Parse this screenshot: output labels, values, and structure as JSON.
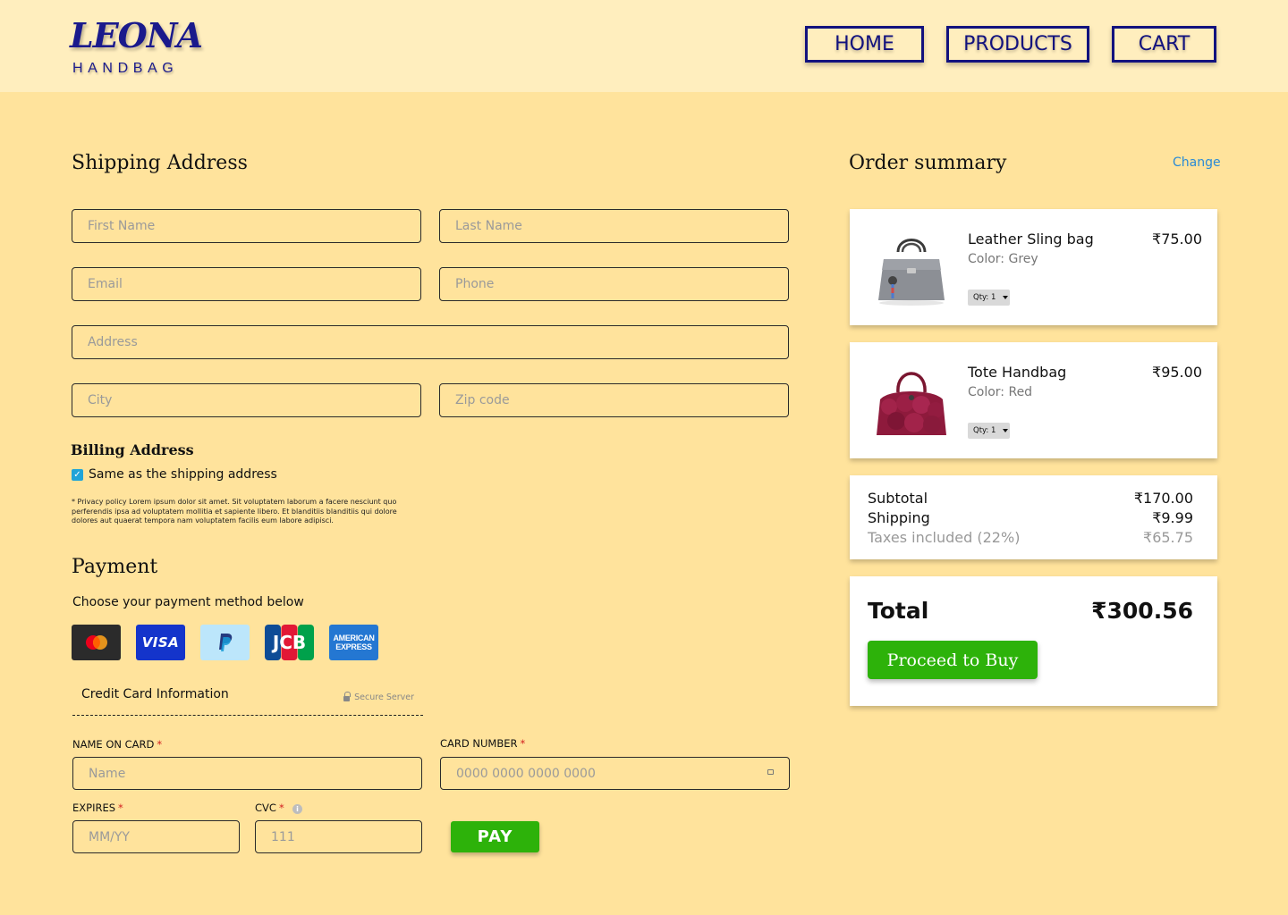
{
  "brand": {
    "mark": "LEONA",
    "sub": "HANDBAG",
    "color": "#1A1A8C"
  },
  "nav": {
    "home": "HOME",
    "products": "PRODUCTS",
    "cart": "CART"
  },
  "shipping": {
    "title": "Shipping Address",
    "first_name": "First Name",
    "last_name": "Last Name",
    "email": "Email",
    "phone": "Phone",
    "address": "Address",
    "city": "City",
    "zip": "Zip code"
  },
  "billing": {
    "title": "Billing Address",
    "same_as_shipping": "Same as the shipping address",
    "same_checked": true,
    "privacy": "* Privacy policy Lorem ipsum dolor sit amet. Sit voluptatem laborum a facere nesciunt quo perferendis ipsa ad voluptatem mollitia et sapiente libero. Et blanditiis blanditiis qui dolore dolores aut quaerat tempora nam voluptatem facilis eum labore adipisci."
  },
  "payment": {
    "title": "Payment",
    "subtitle": "Choose your payment method below",
    "methods": [
      "mastercard-icon",
      "visa-icon",
      "paypal-icon",
      "jcb-icon",
      "amex-icon"
    ],
    "visa_label": "VISA",
    "jcb_label": "JCB",
    "amex_line1": "AMERICAN",
    "amex_line2": "EXPRESS",
    "cc_title": "Credit Card Information",
    "secure": "Secure Server",
    "name_label": "NAME ON CARD",
    "name_placeholder": "Name",
    "number_label": "CARD NUMBER",
    "number_placeholder": "0000 0000 0000 0000",
    "expires_label": "EXPIRES",
    "expires_placeholder": "MM/YY",
    "cvc_label": "CVC",
    "cvc_placeholder": "111",
    "required_mark": "*",
    "pay": "PAY"
  },
  "summary": {
    "title": "Order summary",
    "change": "Change",
    "items": [
      {
        "name": "Leather Sling bag",
        "color": "Color: Grey",
        "price": "₹75.00",
        "qty": "Qty: 1"
      },
      {
        "name": "Tote Handbag",
        "color": "Color: Red",
        "price": "₹95.00",
        "qty": "Qty: 1"
      }
    ],
    "subtotal_label": "Subtotal",
    "subtotal": "₹170.00",
    "shipping_label": "Shipping",
    "shipping": "₹9.99",
    "taxes_label": "Taxes included (22%)",
    "taxes": "₹65.75",
    "total_label": "Total",
    "total": "₹300.56",
    "proceed": "Proceed to Buy"
  },
  "colors": {
    "page_bg": "#FFE39C",
    "header_bg": "#FFEEBE",
    "accent_green": "#2DB20A",
    "nav_blue": "#12127E",
    "link_blue": "#2A8AD6"
  }
}
